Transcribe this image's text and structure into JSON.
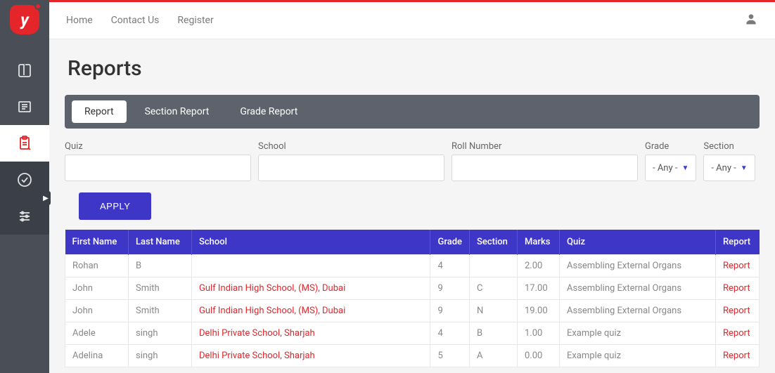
{
  "topnav": {
    "home": "Home",
    "contact": "Contact Us",
    "register": "Register"
  },
  "page_title": "Reports",
  "tabs": [
    {
      "label": "Report",
      "active": true
    },
    {
      "label": "Section Report",
      "active": false
    },
    {
      "label": "Grade Report",
      "active": false
    }
  ],
  "filters": {
    "quiz_label": "Quiz",
    "school_label": "School",
    "roll_label": "Roll Number",
    "grade_label": "Grade",
    "section_label": "Section",
    "grade_value": "- Any -",
    "section_value": "- Any -"
  },
  "apply_label": "APPLY",
  "table": {
    "headers": {
      "first": "First Name",
      "last": "Last Name",
      "school": "School",
      "grade": "Grade",
      "section": "Section",
      "marks": "Marks",
      "quiz": "Quiz",
      "report": "Report"
    },
    "rows": [
      {
        "first": "Rohan",
        "last": "B",
        "school": "",
        "school_link": false,
        "grade": "4",
        "section": "",
        "marks": "2.00",
        "quiz": "Assembling External Organs",
        "report": "Report"
      },
      {
        "first": "John",
        "last": "Smith",
        "school": "Gulf Indian High School, (MS), Dubai",
        "school_link": true,
        "grade": "9",
        "section": "C",
        "marks": "17.00",
        "quiz": "Assembling External Organs",
        "report": "Report"
      },
      {
        "first": "John",
        "last": "Smith",
        "school": "Gulf Indian High School, (MS), Dubai",
        "school_link": true,
        "grade": "9",
        "section": "N",
        "marks": "19.00",
        "quiz": "Assembling External Organs",
        "report": "Report"
      },
      {
        "first": "Adele",
        "last": "singh",
        "school": "Delhi Private School, Sharjah",
        "school_link": true,
        "grade": "4",
        "section": "B",
        "marks": "1.00",
        "quiz": "Example quiz",
        "report": "Report"
      },
      {
        "first": "Adelina",
        "last": "singh",
        "school": "Delhi Private School, Sharjah",
        "school_link": true,
        "grade": "5",
        "section": "A",
        "marks": "0.00",
        "quiz": "Example quiz",
        "report": "Report"
      }
    ]
  }
}
